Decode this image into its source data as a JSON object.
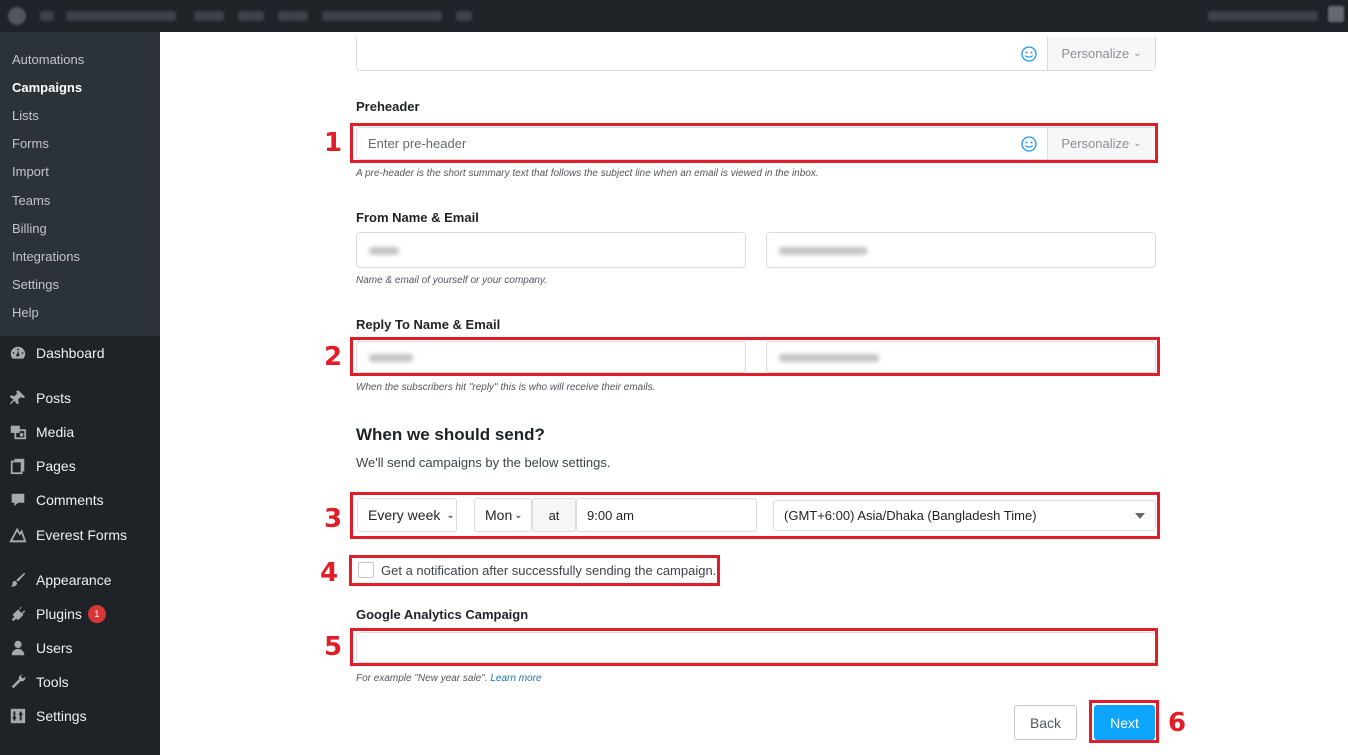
{
  "sidebar": {
    "submenu": [
      "Automations",
      "Campaigns",
      "Lists",
      "Forms",
      "Import",
      "Teams",
      "Billing",
      "Integrations",
      "Settings",
      "Help"
    ],
    "active_submenu": "Campaigns",
    "menu": [
      {
        "label": "Dashboard",
        "icon": "dashboard-icon"
      },
      {
        "label": "Posts",
        "icon": "pin-icon"
      },
      {
        "label": "Media",
        "icon": "media-icon"
      },
      {
        "label": "Pages",
        "icon": "pages-icon"
      },
      {
        "label": "Comments",
        "icon": "comments-icon"
      },
      {
        "label": "Everest Forms",
        "icon": "everest-forms-icon"
      },
      {
        "label": "Appearance",
        "icon": "paintbrush-icon"
      },
      {
        "label": "Plugins",
        "icon": "plugin-icon",
        "badge": "1"
      },
      {
        "label": "Users",
        "icon": "users-icon"
      },
      {
        "label": "Tools",
        "icon": "wrench-icon"
      },
      {
        "label": "Settings",
        "icon": "settings-icon"
      }
    ]
  },
  "form": {
    "subject_personalize": "Personalize",
    "preheader": {
      "label": "Preheader",
      "placeholder": "Enter pre-header",
      "personalize": "Personalize",
      "help": "A pre-header is the short summary text that follows the subject line when an email is viewed in the inbox."
    },
    "from": {
      "label": "From Name & Email",
      "help": "Name & email of yourself or your company."
    },
    "reply_to": {
      "label": "Reply To Name & Email",
      "help": "When the subscribers hit \"reply\" this is who will receive their emails."
    },
    "schedule": {
      "heading": "When we should send?",
      "subtext": "We'll send campaigns by the below settings.",
      "frequency": "Every week",
      "day": "Mon",
      "at": "at",
      "time": "9:00 am",
      "timezone": "(GMT+6:00) Asia/Dhaka (Bangladesh Time)"
    },
    "notification": {
      "label": "Get a notification after successfully sending the campaign.",
      "checked": false
    },
    "analytics": {
      "label": "Google Analytics Campaign",
      "value": "",
      "help_prefix": "For example \"New year sale\".",
      "help_link": "Learn more"
    },
    "buttons": {
      "back": "Back",
      "next": "Next"
    }
  },
  "annotations": [
    "1",
    "2",
    "3",
    "4",
    "5",
    "6"
  ],
  "colors": {
    "annotation_red": "#e11d2a",
    "next_button": "#0ea5ff",
    "sidebar": "#1d2327",
    "submenu": "#2c3338",
    "badge": "#d63638"
  }
}
